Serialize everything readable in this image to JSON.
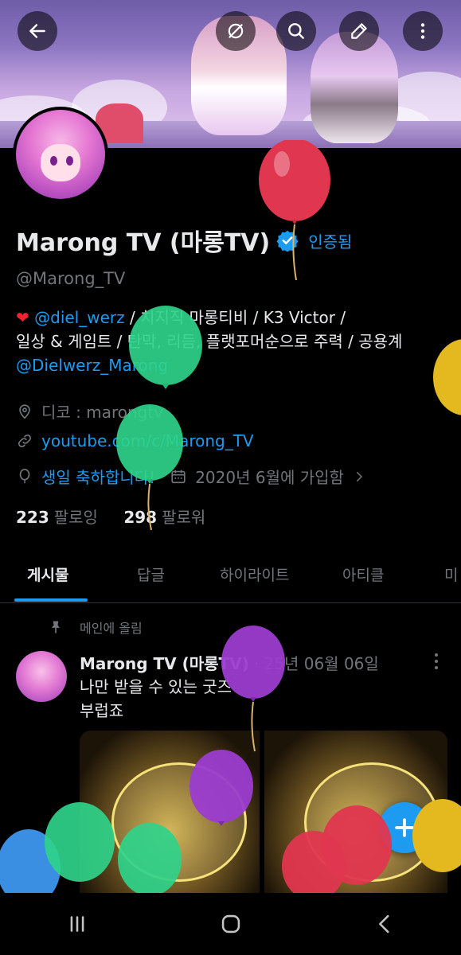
{
  "header": {
    "back_icon": "arrow-left-icon",
    "actions": [
      "grok-icon",
      "search-icon",
      "edit-icon",
      "more-vertical-icon"
    ]
  },
  "profile": {
    "display_name": "Marong TV (마롱TV)",
    "verified_label": "인증됨",
    "handle": "@Marong_TV",
    "bio": {
      "line1_mention": "@diel_werz",
      "line1_rest": " / 치지직 마롱티비 / K3 Victor /",
      "line2": "일상 & 게임트 / 탄막, 리듬, 플랫포머순으로 주력 / 공용계",
      "line3_mention": "@Dielwerz_Marong"
    },
    "location": "디코 : marongtv",
    "website": "youtube.com/c/Marong_TV",
    "birthday": "생일 축하합니다!",
    "joined": "2020년 6월에 가입함",
    "following_count": "223",
    "following_label": "팔로잉",
    "followers_count": "298",
    "followers_label": "팔로워"
  },
  "tabs": [
    "게시물",
    "답글",
    "하이라이트",
    "아티클",
    "미"
  ],
  "post": {
    "pinned_label": "메인에 올림",
    "author": "Marong TV (마롱TV)",
    "date": "· 25년 06월 06일",
    "line1": "나만 받을 수 있는 굿즈",
    "line2": "부럽죠"
  },
  "fab_icon": "plus-icon",
  "nav": [
    "recent-apps-icon",
    "home-icon",
    "back-icon"
  ],
  "colors": {
    "accent": "#1d9bf0",
    "background": "#000000",
    "text_primary": "#e7e9ea",
    "text_secondary": "#71767b"
  }
}
